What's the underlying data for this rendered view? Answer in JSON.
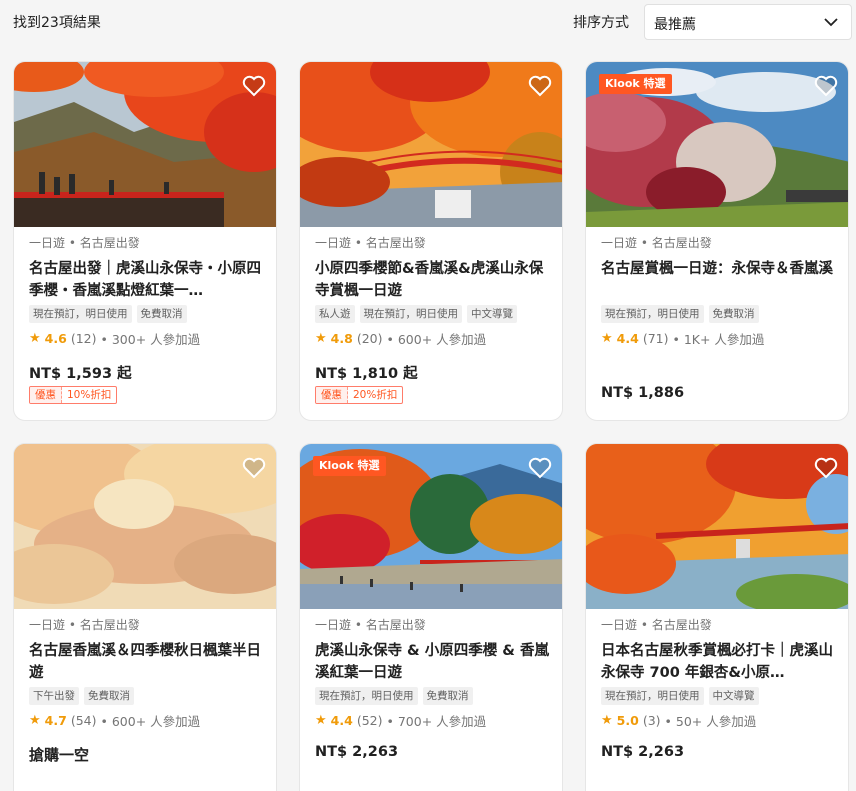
{
  "header": {
    "result_count": "找到23項結果",
    "sort_label": "排序方式",
    "sort_value": "最推薦"
  },
  "cards": [
    {
      "category": "一日遊 • 名古屋出發",
      "title": "名古屋出發｜虎溪山永保寺・小原四季櫻・香嵐溪點燈紅葉一…",
      "tags": [
        "現在預訂，明日使用",
        "免費取消"
      ],
      "rating": "4.6",
      "reviews": "(12)",
      "participants": "• 300+ 人參加過",
      "price": "NT$ 1,593 起",
      "promo_label": "優惠",
      "promo_value": "10%折扣",
      "badge": ""
    },
    {
      "category": "一日遊 • 名古屋出發",
      "title": "小原四季櫻節&香嵐溪&虎溪山永保寺賞楓一日遊",
      "tags": [
        "私人遊",
        "現在預訂，明日使用",
        "中文導覽"
      ],
      "rating": "4.8",
      "reviews": "(20)",
      "participants": "• 600+ 人參加過",
      "price": "NT$ 1,810 起",
      "promo_label": "優惠",
      "promo_value": "20%折扣",
      "badge": ""
    },
    {
      "category": "一日遊 • 名古屋出發",
      "title": "名古屋賞楓一日遊：永保寺＆香嵐溪",
      "tags": [
        "現在預訂，明日使用",
        "免費取消"
      ],
      "rating": "4.4",
      "reviews": "(71)",
      "participants": "• 1K+ 人參加過",
      "price": "NT$ 1,886",
      "badge": "Klook 特選"
    },
    {
      "category": "一日遊 • 名古屋出發",
      "title": "名古屋香嵐溪＆四季櫻秋日楓葉半日遊",
      "tags": [
        "下午出發",
        "免費取消"
      ],
      "rating": "4.7",
      "reviews": "(54)",
      "participants": "• 600+ 人參加過",
      "price": "搶購一空",
      "badge": ""
    },
    {
      "category": "一日遊 • 名古屋出發",
      "title": "虎溪山永保寺 & 小原四季櫻 & 香嵐溪紅葉一日遊",
      "tags": [
        "現在預訂，明日使用",
        "免費取消"
      ],
      "rating": "4.4",
      "reviews": "(52)",
      "participants": "• 700+ 人參加過",
      "price": "NT$ 2,263",
      "badge": "Klook 特選"
    },
    {
      "category": "一日遊 • 名古屋出發",
      "title": "日本名古屋秋季賞楓必打卡｜虎溪山永保寺 700 年銀杏&小原…",
      "tags": [
        "現在預訂，明日使用",
        "中文導覽"
      ],
      "rating": "5.0",
      "reviews": "(3)",
      "participants": "• 50+ 人參加過",
      "price": "NT$ 2,263",
      "badge": ""
    }
  ],
  "colors": {
    "accent": "#ff5722",
    "star": "#f09b0a"
  }
}
